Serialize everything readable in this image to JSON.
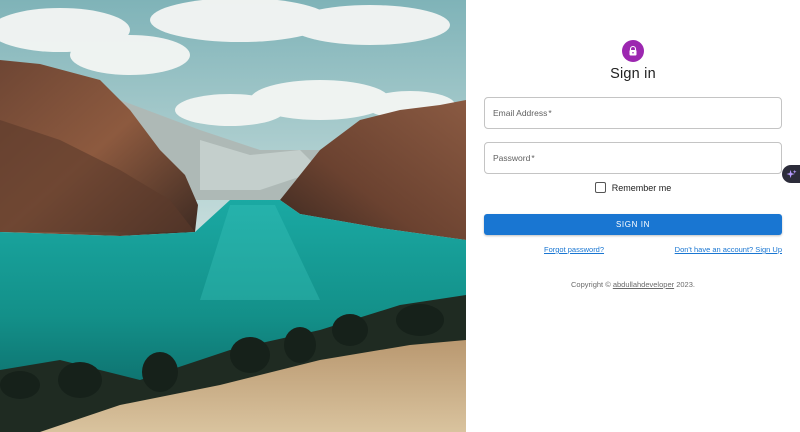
{
  "form": {
    "title": "Sign in",
    "email": {
      "label": "Email Address",
      "required_marker": "*",
      "value": ""
    },
    "password": {
      "label": "Password",
      "required_marker": "*",
      "value": ""
    },
    "remember": {
      "label": "Remember me",
      "checked": false
    },
    "submit_label": "Sign In",
    "forgot_link": "Forgot password?",
    "signup_link": "Don't have an account? Sign Up"
  },
  "footer": {
    "prefix": "Copyright © ",
    "author": "abdullahdeveloper",
    "suffix": " 2023."
  },
  "icons": {
    "avatar": "lock-icon",
    "assist": "sparkle-icon"
  },
  "colors": {
    "primary": "#1976d2",
    "avatar_bg": "#9c27b0"
  }
}
